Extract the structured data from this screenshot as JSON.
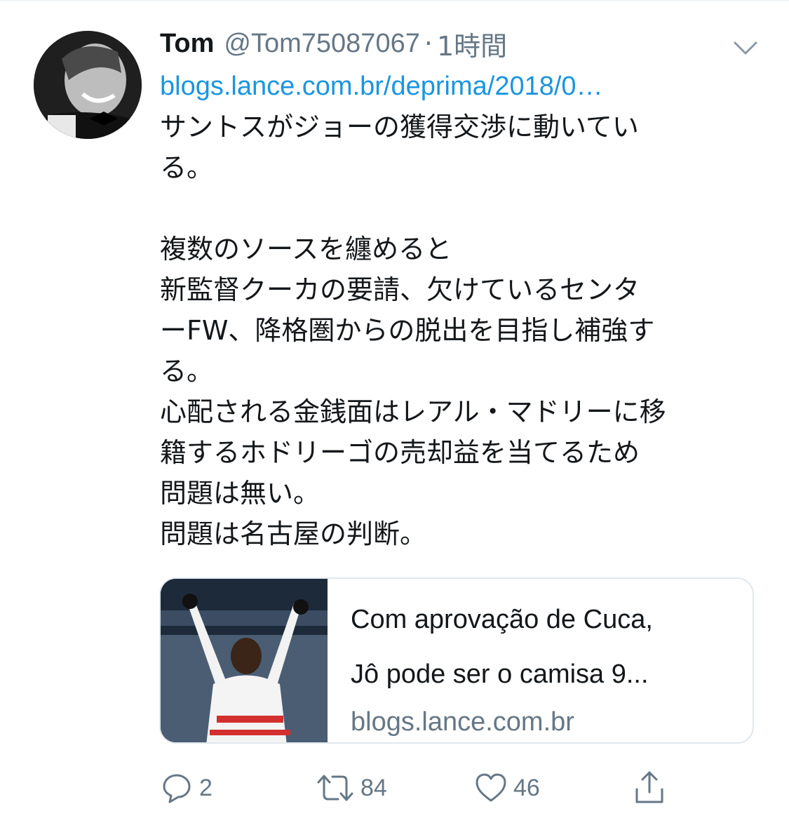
{
  "tweet": {
    "author_name": "Tom",
    "handle": "@Tom75087067",
    "separator": "·",
    "time": "1時間",
    "link": "blogs.lance.com.br/deprima/2018/0…",
    "lines": [
      "サントスがジョーの獲得交渉に動いてい",
      "る。",
      "",
      "複数のソースを纏めると",
      "新監督クーカの要請、欠けているセンタ",
      "ーFW、降格圏からの脱出を目指し補強す",
      "る。",
      "心配される金銭面はレアル・マドリーに移",
      "籍するホドリーゴの売却益を当てるため",
      "問題は無い。",
      "問題は名古屋の判断。"
    ]
  },
  "card": {
    "title_line1": "Com aprovação de Cuca,",
    "title_line2": "Jô pode ser o camisa 9...",
    "domain": "blogs.lance.com.br"
  },
  "actions": {
    "reply_count": "2",
    "retweet_count": "84",
    "like_count": "46"
  },
  "icons": {
    "menu": "chevron-down-icon",
    "reply": "reply-icon",
    "retweet": "retweet-icon",
    "like": "heart-icon",
    "share": "share-icon"
  },
  "colors": {
    "link": "#1b95e0",
    "secondary": "#657786",
    "primary_text": "#14171a",
    "border": "#e1e8ed"
  }
}
